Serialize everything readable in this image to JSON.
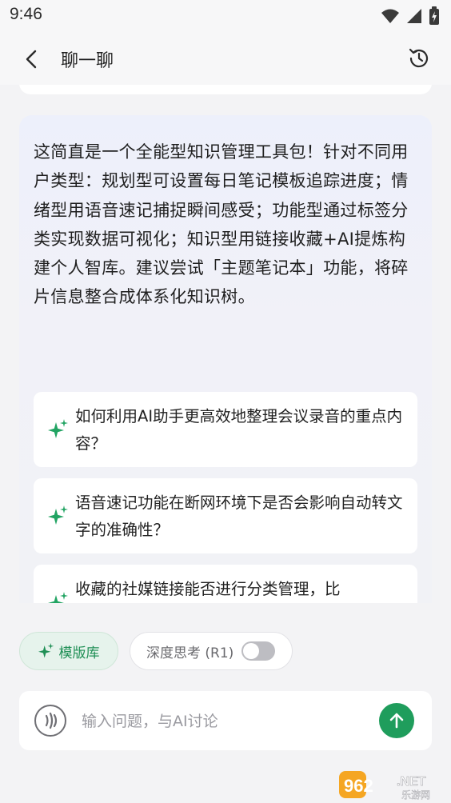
{
  "status_bar": {
    "time": "9:46"
  },
  "header": {
    "title": "聊一聊"
  },
  "conversation": {
    "ai_message": "这简直是一个全能型知识管理工具包！针对不同用户类型：规划型可设置每日笔记模板追踪进度；情绪型用语音速记捕捉瞬间感受；功能型通过标签分类实现数据可视化；知识型用链接收藏+AI提炼构建个人智库。建议尝试「主题笔记本」功能，将碎片信息整合成体系化知识树。",
    "suggestions": [
      {
        "text": "如何利用AI助手更高效地整理会议录音的重点内容？"
      },
      {
        "text": "语音速记功能在断网环境下是否会影响自动转文字的准确性？"
      },
      {
        "text": "收藏的社媒链接能否进行分类管理，比"
      }
    ]
  },
  "toolbar": {
    "template_label": "模版库",
    "deep_think_label": "深度思考 (R1)",
    "deep_think_enabled": false
  },
  "composer": {
    "placeholder": "输入问题，与AI讨论"
  },
  "watermark": {
    "number": "962",
    "suffix": ".NET",
    "site": "乐游网"
  },
  "colors": {
    "accent": "#1f9d5c",
    "background": "#f3f3f5"
  }
}
